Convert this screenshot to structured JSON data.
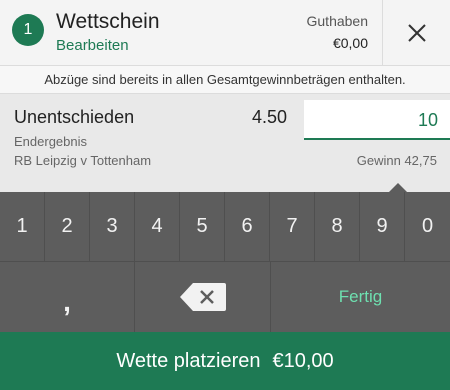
{
  "header": {
    "count": "1",
    "title": "Wettschein",
    "edit": "Bearbeiten",
    "balance_label": "Guthaben",
    "balance_value": "€0,00",
    "close_icon": "close-icon"
  },
  "notice": "Abzüge sind bereits in allen Gesamtgewinnbeträgen enthalten.",
  "bet": {
    "selection": "Unentschieden",
    "odds": "4.50",
    "market": "Endergebnis",
    "event": "RB Leipzig v Tottenham",
    "stake": "10",
    "return": "Gewinn 42,75"
  },
  "keypad": {
    "digits": [
      "1",
      "2",
      "3",
      "4",
      "5",
      "6",
      "7",
      "8",
      "9",
      "0"
    ],
    "comma": ",",
    "backspace_icon": "backspace-icon",
    "done": "Fertig"
  },
  "place_bet": {
    "label": "Wette platzieren",
    "amount": "€10,00"
  },
  "colors": {
    "accent": "#1e7a54",
    "keypad_bg": "#5d5d5d",
    "done_text": "#6ee0b0"
  }
}
